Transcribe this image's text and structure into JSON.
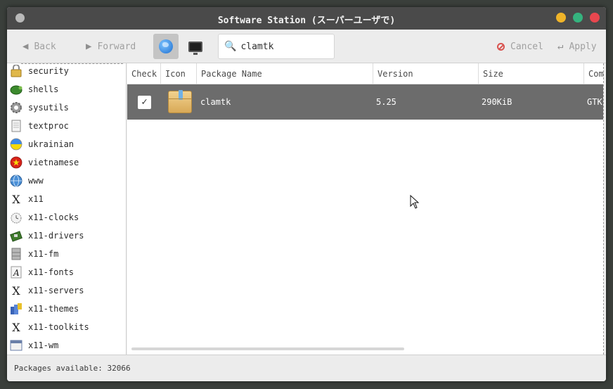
{
  "window": {
    "title": "Software Station (スーパーユーザで)",
    "controls": {
      "minimize_color": "#f0b429",
      "maximize_color": "#35b37e",
      "close_color": "#e8474f"
    }
  },
  "toolbar": {
    "back_label": "Back",
    "forward_label": "Forward",
    "search_value": "clamtk",
    "cancel_label": "Cancel",
    "apply_label": "Apply"
  },
  "sidebar": {
    "items": [
      {
        "label": "security",
        "icon": "lock-icon"
      },
      {
        "label": "shells",
        "icon": "turtle-shell-icon"
      },
      {
        "label": "sysutils",
        "icon": "gear-icon"
      },
      {
        "label": "textproc",
        "icon": "document-icon"
      },
      {
        "label": "ukrainian",
        "icon": "ukraine-flag-icon"
      },
      {
        "label": "vietnamese",
        "icon": "vietnam-flag-icon"
      },
      {
        "label": "www",
        "icon": "globe-icon"
      },
      {
        "label": "x11",
        "icon": "x-logo-icon"
      },
      {
        "label": "x11-clocks",
        "icon": "clock-icon"
      },
      {
        "label": "x11-drivers",
        "icon": "circuit-board-icon"
      },
      {
        "label": "x11-fm",
        "icon": "file-cabinet-icon"
      },
      {
        "label": "x11-fonts",
        "icon": "font-icon"
      },
      {
        "label": "x11-servers",
        "icon": "x-logo-icon"
      },
      {
        "label": "x11-themes",
        "icon": "themes-icon"
      },
      {
        "label": "x11-toolkits",
        "icon": "x-logo-icon"
      },
      {
        "label": "x11-wm",
        "icon": "window-icon"
      }
    ]
  },
  "table": {
    "columns": [
      "Check",
      "Icon",
      "Package Name",
      "Version",
      "Size",
      "Comment"
    ],
    "rows": [
      {
        "checked": true,
        "icon": "package-box-icon",
        "name": "clamtk",
        "version": "5.25",
        "size": "290KiB",
        "comment": "GTK"
      }
    ],
    "selected_row_color": "#6c6c6c"
  },
  "status": {
    "text": "Packages available: 32066"
  }
}
